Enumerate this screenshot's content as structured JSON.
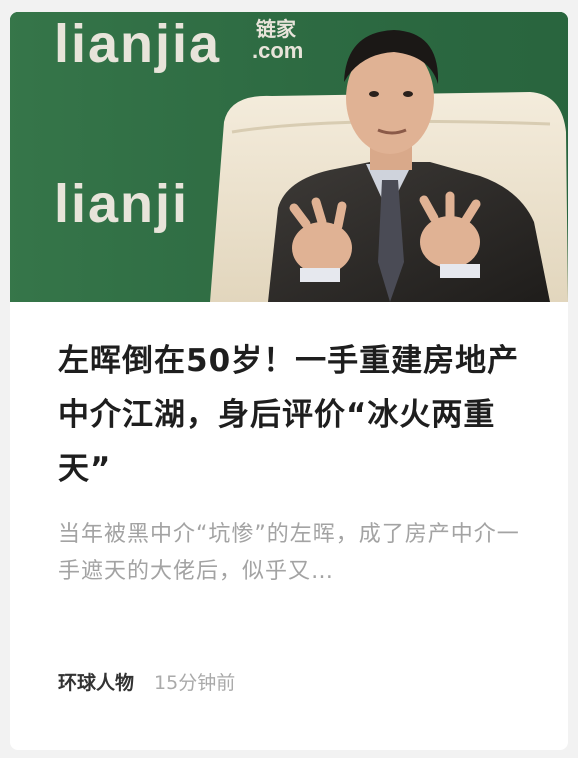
{
  "article": {
    "image_logo_top": "lianjia",
    "image_logo_cn": "链家",
    "image_logo_dotcom": ".com",
    "image_logo_bottom": "lianji",
    "title": "左晖倒在50岁！一手重建房地产中介江湖，身后评价“冰火两重天”",
    "summary": "当年被黑中介“坑惨”的左晖，成了房产中介一手遮天的大佬后，似乎又…",
    "source": "环球人物",
    "time": "15分钟前"
  },
  "colors": {
    "backdrop_green": "#2f6f44",
    "title_text": "#1e1e1e",
    "summary_text": "#a3a3a3"
  }
}
